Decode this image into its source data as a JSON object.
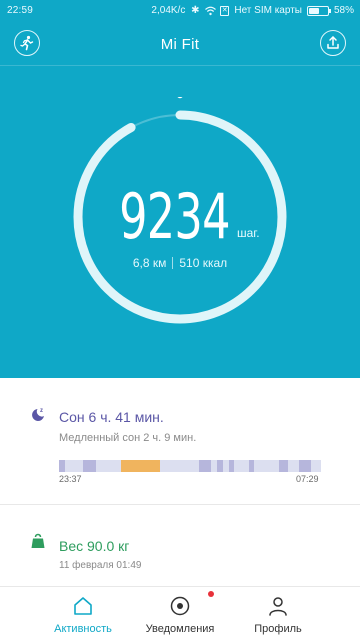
{
  "status_bar": {
    "time": "22:59",
    "network_speed": "2,04K/c",
    "sim_status": "Нет SIM карты",
    "battery": "58%",
    "battery_level": 0.58
  },
  "header": {
    "title": "Mi Fit",
    "left_icon": "running-person-icon",
    "right_icon": "upload-icon"
  },
  "activity": {
    "steps": "9234",
    "steps_unit": "шаг.",
    "distance": "6,8 км",
    "calories": "510 ккал",
    "goal_progress": 0.92
  },
  "sleep": {
    "icon": "moon-zz-icon",
    "title": "Сон 6 ч. 41 мин.",
    "subtitle": "Медленный сон 2 ч. 9 мин.",
    "start_time": "23:37",
    "end_time": "07:29"
  },
  "weight": {
    "icon": "weight-icon",
    "title": "Вес 90.0 кг",
    "date": "11 февраля 01:49"
  },
  "bottom_nav": {
    "items": [
      {
        "label": "Активность",
        "icon": "home-icon",
        "active": true
      },
      {
        "label": "Уведомления",
        "icon": "notification-circle-icon",
        "active": false,
        "badge": true
      },
      {
        "label": "Профиль",
        "icon": "profile-icon",
        "active": false
      }
    ]
  },
  "colors": {
    "primary": "#0fa8c7",
    "sleep_accent": "#5b57a6",
    "weight_accent": "#2e9d5e",
    "awake": "#f0b45e",
    "deep_sleep": "#b6b6dc",
    "light_sleep": "#dcdff0",
    "badge": "#e8313a"
  }
}
